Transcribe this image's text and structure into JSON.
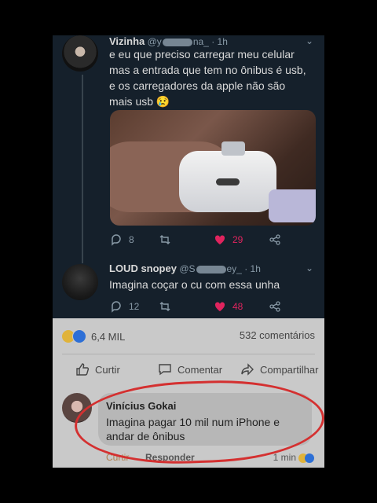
{
  "tweet1": {
    "name": "Vizinha",
    "handle_prefix": "@y",
    "handle_suffix": "na_",
    "time": "· 1h",
    "text_lines": [
      "e eu que preciso carregar meu celular",
      "mas a entrada que tem no ônibus é usb,",
      "e os carregadores da apple não são",
      "mais usb 😢"
    ],
    "replies": "8",
    "retweets": "",
    "likes": "29"
  },
  "tweet2": {
    "name": "LOUD snopey",
    "handle_prefix": "@S",
    "handle_suffix": "ey_",
    "time": "· 1h",
    "text": "Imagina coçar o cu com essa unha",
    "replies": "12",
    "retweets": "",
    "likes": "48"
  },
  "fb": {
    "reaction_count": "6,4 MIL",
    "comments_count": "532 comentários",
    "like_label": "Curtir",
    "comment_label": "Comentar",
    "share_label": "Compartilhar",
    "comment": {
      "author": "Vinícius Gokai",
      "text": "Imagina pagar 10 mil num iPhone e andar de ônibus",
      "like_label": "Curtir",
      "reply_label": "Responder",
      "time": "1 min"
    }
  },
  "colors": {
    "twitter_bg": "#15202b",
    "like_red": "#e0245e",
    "fb_bg": "#c9c9c9",
    "annotation_red": "#d43030"
  }
}
